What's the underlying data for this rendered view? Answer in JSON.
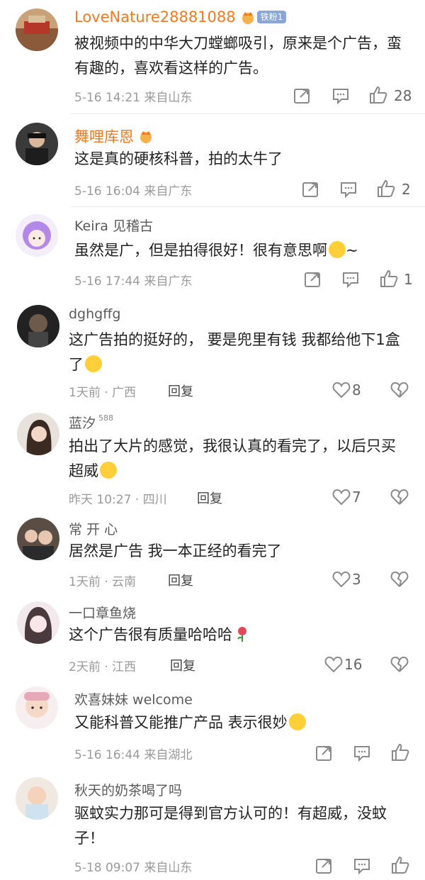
{
  "comments": [
    {
      "name": "LoveNature28881088",
      "badge": "铁粉1",
      "text": "被视频中的中华大刀螳螂吸引，原来是个广告，蛮有趣的，喜欢看这样的广告。",
      "meta": "5-16 14:21 来自山东",
      "likes": "28"
    },
    {
      "name": "舞哩库恩",
      "text": "这是真的硬核科普，拍的太牛了",
      "meta": "5-16 16:04 来自广东",
      "likes": "2"
    },
    {
      "name": "Keira 见稽古",
      "text": "虽然是广，但是拍得很好！很有意思啊",
      "text_tail": "~",
      "meta": "5-16 17:44 来自广东",
      "likes": "1"
    },
    {
      "name": "dghgffg",
      "text": "这广告拍的挺好的， 要是兜里有钱 我都给他下1盒了",
      "meta": "1天前 · 广西",
      "reply": "回复",
      "likes": "8"
    },
    {
      "name": "蓝汐",
      "sup": "588",
      "text": "拍出了大片的感觉，我很认真的看完了，以后只买超威",
      "meta": "昨天 10:27 · 四川",
      "reply": "回复",
      "likes": "7"
    },
    {
      "name": "常 开 心",
      "text": "居然是广告 我一本正经的看完了",
      "meta": "1天前 · 云南",
      "reply": "回复",
      "likes": "3"
    },
    {
      "name": "一口章鱼烧",
      "text": "这个广告很有质量哈哈哈",
      "meta": "2天前 · 江西",
      "reply": "回复",
      "likes": "16"
    },
    {
      "name": "欢喜妹妹 welcome",
      "text": "又能科普又能推广产品 表示很妙",
      "meta": "5-16 16:44 来自湖北",
      "likes": ""
    },
    {
      "name": "秋天的奶茶喝了吗",
      "text": "驱蚊实力那可是得到官方认可的！有超威，没蚊子！",
      "meta": "5-18 09:07 来自山东",
      "likes": ""
    }
  ],
  "icons": {
    "share": "share-icon",
    "comment": "comment-icon",
    "like": "thumbs-up-icon",
    "heart": "heart-icon",
    "broken_heart": "broken-heart-icon",
    "crown": "crown-icon"
  },
  "colors": {
    "name_orange": "#f07a21",
    "text": "#222222",
    "meta": "#9a9a9a",
    "icon": "#8a8a8a"
  }
}
